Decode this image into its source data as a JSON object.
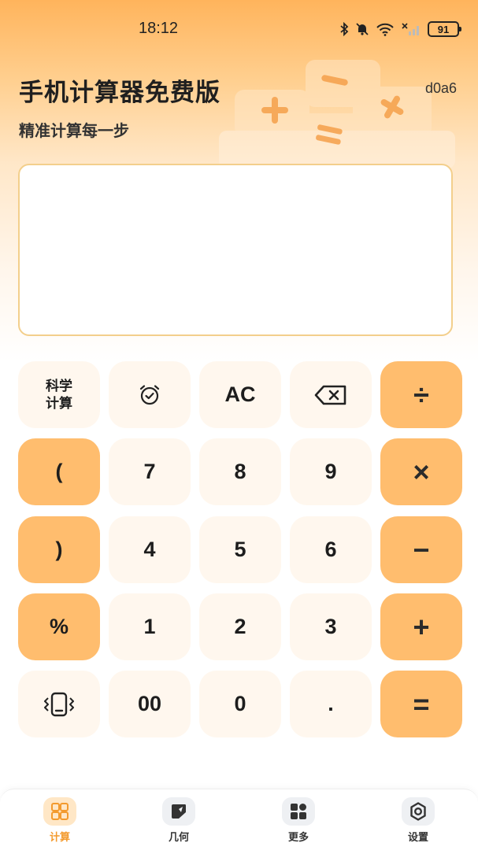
{
  "status_bar": {
    "time": "18:12",
    "battery": "91"
  },
  "header": {
    "title": "手机计算器免费版",
    "subtitle": "精准计算每一步",
    "code": "d0a6"
  },
  "display": {
    "value": ""
  },
  "keys": {
    "scientific": "科学",
    "scientific_line2": "计算",
    "ac": "AC",
    "divide": "÷",
    "open_paren": "(",
    "seven": "7",
    "eight": "8",
    "nine": "9",
    "multiply": "×",
    "close_paren": ")",
    "four": "4",
    "five": "5",
    "six": "6",
    "minus": "−",
    "percent": "%",
    "one": "1",
    "two": "2",
    "three": "3",
    "plus": "+",
    "double_zero": "00",
    "zero": "0",
    "dot": ".",
    "equals": "="
  },
  "nav": {
    "calc": "计算",
    "geometry": "几何",
    "more": "更多",
    "settings": "设置"
  },
  "colors": {
    "accent_orange": "#ffbd6e",
    "key_light": "#fff7ee",
    "active_nav": "#f39a2d"
  }
}
